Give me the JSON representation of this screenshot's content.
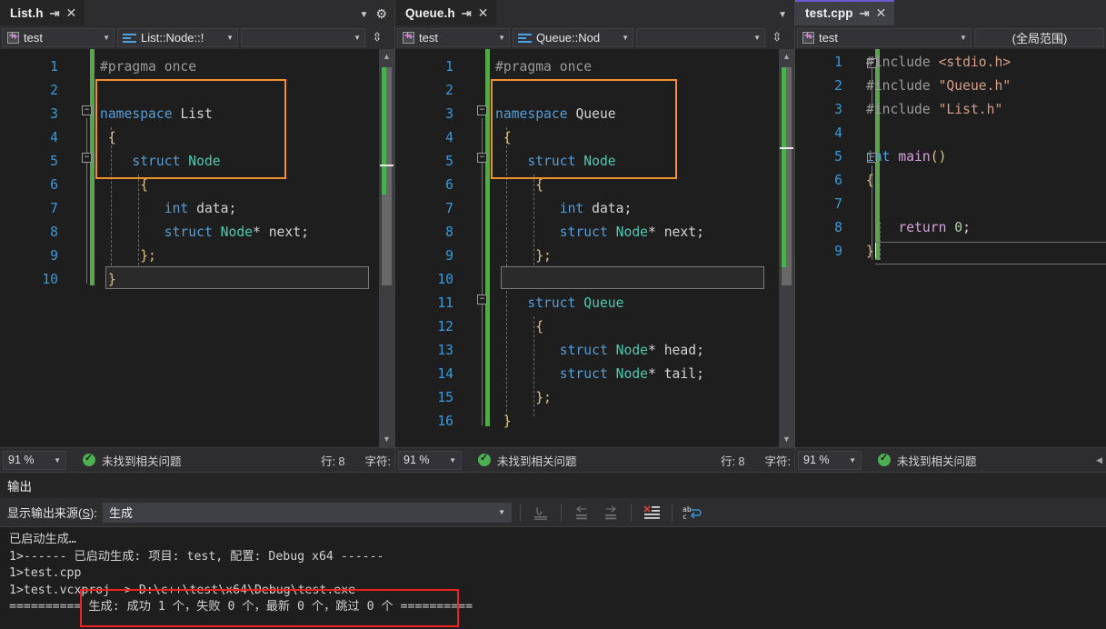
{
  "theme": {
    "accent_tab": "#6a5acd",
    "annotation_orange": "#f0912d",
    "annotation_red": "#ee2222",
    "change_bar_green": "#57a64a",
    "status_ok_green": "#4caf50",
    "editor_bg": "#1e1e1e",
    "chrome_bg": "#2d2d30"
  },
  "panes": [
    {
      "tab": {
        "title": "List.h",
        "pin_icon": "pin-icon",
        "close_icon": "close-icon",
        "active": false
      },
      "tabstrip": {
        "chevron_icon": "chevron-down-icon",
        "gear_icon": "gear-icon"
      },
      "nav": {
        "project": "test",
        "project_icon": "cpp-project-icon",
        "scope": "List::Node::!",
        "scope_icon": "member-icon",
        "member": "",
        "split_icon": "split-view-icon",
        "dropdown_arrow": "chevron-down-icon"
      },
      "lines": [
        {
          "n": "1",
          "segments": [
            {
              "t": "#pragma once",
              "c": "pp"
            }
          ]
        },
        {
          "n": "2",
          "segments": []
        },
        {
          "n": "3",
          "segments": [
            {
              "t": "namespace ",
              "c": "kw"
            },
            {
              "t": "List",
              "c": "br"
            }
          ],
          "fold": "minus"
        },
        {
          "n": "4",
          "segments": [
            {
              "t": " {",
              "c": "brc1"
            }
          ]
        },
        {
          "n": "5",
          "segments": [
            {
              "t": "    struct ",
              "c": "kw"
            },
            {
              "t": "Node",
              "c": "ty"
            }
          ],
          "fold": "minus"
        },
        {
          "n": "6",
          "segments": [
            {
              "t": "     {",
              "c": "brc1"
            }
          ]
        },
        {
          "n": "7",
          "segments": [
            {
              "t": "        ",
              "c": "br"
            },
            {
              "t": "int",
              "c": "kw"
            },
            {
              "t": " data;",
              "c": "br"
            }
          ]
        },
        {
          "n": "8",
          "segments": [
            {
              "t": "        ",
              "c": "br"
            },
            {
              "t": "struct ",
              "c": "kw"
            },
            {
              "t": "Node",
              "c": "ty"
            },
            {
              "t": "* next;",
              "c": "br"
            }
          ],
          "selected": true
        },
        {
          "n": "9",
          "segments": [
            {
              "t": "     };",
              "c": "brc1"
            }
          ]
        },
        {
          "n": "10",
          "segments": [
            {
              "t": " }",
              "c": "brc1"
            }
          ]
        }
      ],
      "status": {
        "zoom": "91 %",
        "zoom_arrow": "chevron-down-icon",
        "ok_icon": "check-circle-icon",
        "message": "未找到相关问题",
        "line_label": "行: 8",
        "char_label": "字符:"
      }
    },
    {
      "tab": {
        "title": "Queue.h",
        "pin_icon": "pin-icon",
        "close_icon": "close-icon",
        "active": false
      },
      "tabstrip": {
        "chevron_icon": "chevron-down-icon",
        "gear_icon": ""
      },
      "nav": {
        "project": "test",
        "project_icon": "cpp-project-icon",
        "scope": "Queue::Nod",
        "scope_icon": "member-icon",
        "member": "",
        "split_icon": "split-view-icon",
        "dropdown_arrow": "chevron-down-icon"
      },
      "lines": [
        {
          "n": "1",
          "segments": [
            {
              "t": "#pragma once",
              "c": "pp"
            }
          ]
        },
        {
          "n": "2",
          "segments": []
        },
        {
          "n": "3",
          "segments": [
            {
              "t": "namespace ",
              "c": "kw"
            },
            {
              "t": "Queue",
              "c": "br"
            }
          ],
          "fold": "minus"
        },
        {
          "n": "4",
          "segments": [
            {
              "t": " {",
              "c": "brc1"
            }
          ]
        },
        {
          "n": "5",
          "segments": [
            {
              "t": "    struct ",
              "c": "kw"
            },
            {
              "t": "Node",
              "c": "ty"
            }
          ],
          "fold": "minus"
        },
        {
          "n": "6",
          "segments": [
            {
              "t": "     {",
              "c": "brc1"
            }
          ]
        },
        {
          "n": "7",
          "segments": [
            {
              "t": "        ",
              "c": "br"
            },
            {
              "t": "int",
              "c": "kw"
            },
            {
              "t": " data;",
              "c": "br"
            }
          ]
        },
        {
          "n": "8",
          "segments": [
            {
              "t": "        ",
              "c": "br"
            },
            {
              "t": "struct ",
              "c": "kw"
            },
            {
              "t": "Node",
              "c": "ty"
            },
            {
              "t": "* next;",
              "c": "br"
            }
          ],
          "selected": true
        },
        {
          "n": "9",
          "segments": [
            {
              "t": "     };",
              "c": "brc1"
            }
          ]
        },
        {
          "n": "10",
          "segments": []
        },
        {
          "n": "11",
          "segments": [
            {
              "t": "    struct ",
              "c": "kw"
            },
            {
              "t": "Queue",
              "c": "ty"
            }
          ],
          "fold": "minus"
        },
        {
          "n": "12",
          "segments": [
            {
              "t": "     {",
              "c": "brc1"
            }
          ]
        },
        {
          "n": "13",
          "segments": [
            {
              "t": "        ",
              "c": "br"
            },
            {
              "t": "struct ",
              "c": "kw"
            },
            {
              "t": "Node",
              "c": "ty"
            },
            {
              "t": "* head;",
              "c": "br"
            }
          ]
        },
        {
          "n": "14",
          "segments": [
            {
              "t": "        ",
              "c": "br"
            },
            {
              "t": "struct ",
              "c": "kw"
            },
            {
              "t": "Node",
              "c": "ty"
            },
            {
              "t": "* tail;",
              "c": "br"
            }
          ]
        },
        {
          "n": "15",
          "segments": [
            {
              "t": "     };",
              "c": "brc1"
            }
          ]
        },
        {
          "n": "16",
          "segments": [
            {
              "t": " }",
              "c": "brc1"
            }
          ]
        }
      ],
      "status": {
        "zoom": "91 %",
        "zoom_arrow": "chevron-down-icon",
        "ok_icon": "check-circle-icon",
        "message": "未找到相关问题",
        "line_label": "行: 8",
        "char_label": "字符:"
      }
    },
    {
      "tab": {
        "title": "test.cpp",
        "pin_icon": "pin-icon",
        "close_icon": "close-icon",
        "active": true
      },
      "tabstrip": {
        "chevron_icon": "",
        "gear_icon": ""
      },
      "nav": {
        "project": "test",
        "project_icon": "cpp-project-icon",
        "scope": "(全局范围)",
        "scope_icon": "",
        "member": "",
        "split_icon": "",
        "dropdown_arrow": "chevron-down-icon"
      },
      "lines": [
        {
          "n": "1",
          "segments": [
            {
              "t": "#include ",
              "c": "pp"
            },
            {
              "t": "<stdio.h>",
              "c": "str"
            }
          ],
          "fold": "minus"
        },
        {
          "n": "2",
          "segments": [
            {
              "t": "#include ",
              "c": "pp"
            },
            {
              "t": "\"Queue.h\"",
              "c": "str"
            }
          ]
        },
        {
          "n": "3",
          "segments": [
            {
              "t": "#include ",
              "c": "pp"
            },
            {
              "t": "\"List.h\"",
              "c": "str"
            }
          ]
        },
        {
          "n": "4",
          "segments": []
        },
        {
          "n": "5",
          "segments": [
            {
              "t": "int",
              "c": "kw"
            },
            {
              "t": " ",
              "c": "br"
            },
            {
              "t": "main",
              "c": "ctrl"
            },
            {
              "t": "()",
              "c": "brc1"
            }
          ],
          "fold": "minus"
        },
        {
          "n": "6",
          "segments": [
            {
              "t": "{",
              "c": "brc1"
            }
          ]
        },
        {
          "n": "7",
          "segments": []
        },
        {
          "n": "8",
          "segments": [
            {
              "t": "    ",
              "c": "br"
            },
            {
              "t": "return",
              "c": "ctrl"
            },
            {
              "t": " ",
              "c": "br"
            },
            {
              "t": "0",
              "c": "num0"
            },
            {
              "t": ";",
              "c": "br"
            }
          ]
        },
        {
          "n": "9",
          "segments": [
            {
              "t": "}",
              "c": "brc1"
            }
          ],
          "caret": true
        }
      ],
      "status": {
        "zoom": "91 %",
        "zoom_arrow": "chevron-down-icon",
        "ok_icon": "check-circle-icon",
        "message": "未找到相关问题",
        "line_label": "",
        "char_label": "",
        "overflow_arrow": "chevron-left-icon"
      }
    }
  ],
  "output": {
    "title": "输出",
    "source_label_prefix": "显示输出来源",
    "source_label_key": "S",
    "source_label_suffix": ":",
    "source_value": "生成",
    "source_arrow": "chevron-down-icon",
    "toolbar_icons": [
      {
        "name": "find-message-source-icon",
        "enabled": false
      },
      {
        "name": "go-to-previous-message-icon",
        "enabled": false
      },
      {
        "name": "go-to-next-message-icon",
        "enabled": false
      },
      {
        "name": "clear-all-icon",
        "enabled": true
      },
      {
        "name": "toggle-word-wrap-icon",
        "enabled": true
      }
    ],
    "lines": [
      "已启动生成…",
      "1>------ 已启动生成: 项目: test, 配置: Debug x64 ------",
      "1>test.cpp",
      "1>test.vcxproj -> D:\\c++\\test\\x64\\Debug\\test.exe",
      "========== 生成: 成功 1 个，失败 0 个，最新 0 个，跳过 0 个 =========="
    ]
  },
  "annotations": [
    {
      "name": "orange-box-list-namespace",
      "color": "#f0912d"
    },
    {
      "name": "orange-box-queue-namespace",
      "color": "#f0912d"
    },
    {
      "name": "red-box-build-summary",
      "color": "#ee2222"
    }
  ]
}
